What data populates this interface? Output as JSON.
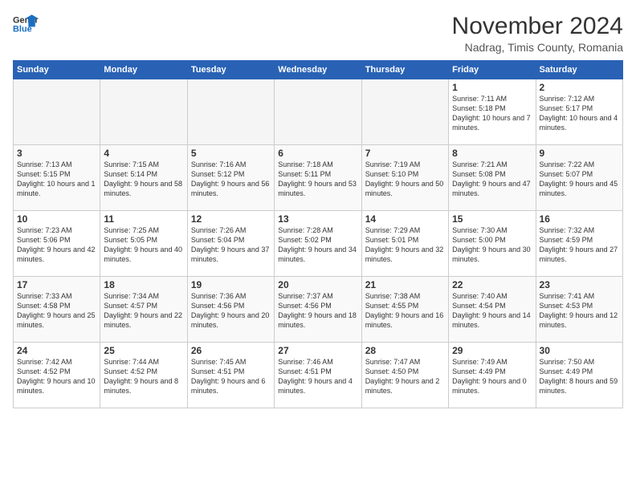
{
  "header": {
    "logo_line1": "General",
    "logo_line2": "Blue",
    "month": "November 2024",
    "location": "Nadrag, Timis County, Romania"
  },
  "weekdays": [
    "Sunday",
    "Monday",
    "Tuesday",
    "Wednesday",
    "Thursday",
    "Friday",
    "Saturday"
  ],
  "weeks": [
    [
      {
        "day": "",
        "info": ""
      },
      {
        "day": "",
        "info": ""
      },
      {
        "day": "",
        "info": ""
      },
      {
        "day": "",
        "info": ""
      },
      {
        "day": "",
        "info": ""
      },
      {
        "day": "1",
        "info": "Sunrise: 7:11 AM\nSunset: 5:18 PM\nDaylight: 10 hours\nand 7 minutes."
      },
      {
        "day": "2",
        "info": "Sunrise: 7:12 AM\nSunset: 5:17 PM\nDaylight: 10 hours\nand 4 minutes."
      }
    ],
    [
      {
        "day": "3",
        "info": "Sunrise: 7:13 AM\nSunset: 5:15 PM\nDaylight: 10 hours\nand 1 minute."
      },
      {
        "day": "4",
        "info": "Sunrise: 7:15 AM\nSunset: 5:14 PM\nDaylight: 9 hours\nand 58 minutes."
      },
      {
        "day": "5",
        "info": "Sunrise: 7:16 AM\nSunset: 5:12 PM\nDaylight: 9 hours\nand 56 minutes."
      },
      {
        "day": "6",
        "info": "Sunrise: 7:18 AM\nSunset: 5:11 PM\nDaylight: 9 hours\nand 53 minutes."
      },
      {
        "day": "7",
        "info": "Sunrise: 7:19 AM\nSunset: 5:10 PM\nDaylight: 9 hours\nand 50 minutes."
      },
      {
        "day": "8",
        "info": "Sunrise: 7:21 AM\nSunset: 5:08 PM\nDaylight: 9 hours\nand 47 minutes."
      },
      {
        "day": "9",
        "info": "Sunrise: 7:22 AM\nSunset: 5:07 PM\nDaylight: 9 hours\nand 45 minutes."
      }
    ],
    [
      {
        "day": "10",
        "info": "Sunrise: 7:23 AM\nSunset: 5:06 PM\nDaylight: 9 hours\nand 42 minutes."
      },
      {
        "day": "11",
        "info": "Sunrise: 7:25 AM\nSunset: 5:05 PM\nDaylight: 9 hours\nand 40 minutes."
      },
      {
        "day": "12",
        "info": "Sunrise: 7:26 AM\nSunset: 5:04 PM\nDaylight: 9 hours\nand 37 minutes."
      },
      {
        "day": "13",
        "info": "Sunrise: 7:28 AM\nSunset: 5:02 PM\nDaylight: 9 hours\nand 34 minutes."
      },
      {
        "day": "14",
        "info": "Sunrise: 7:29 AM\nSunset: 5:01 PM\nDaylight: 9 hours\nand 32 minutes."
      },
      {
        "day": "15",
        "info": "Sunrise: 7:30 AM\nSunset: 5:00 PM\nDaylight: 9 hours\nand 30 minutes."
      },
      {
        "day": "16",
        "info": "Sunrise: 7:32 AM\nSunset: 4:59 PM\nDaylight: 9 hours\nand 27 minutes."
      }
    ],
    [
      {
        "day": "17",
        "info": "Sunrise: 7:33 AM\nSunset: 4:58 PM\nDaylight: 9 hours\nand 25 minutes."
      },
      {
        "day": "18",
        "info": "Sunrise: 7:34 AM\nSunset: 4:57 PM\nDaylight: 9 hours\nand 22 minutes."
      },
      {
        "day": "19",
        "info": "Sunrise: 7:36 AM\nSunset: 4:56 PM\nDaylight: 9 hours\nand 20 minutes."
      },
      {
        "day": "20",
        "info": "Sunrise: 7:37 AM\nSunset: 4:56 PM\nDaylight: 9 hours\nand 18 minutes."
      },
      {
        "day": "21",
        "info": "Sunrise: 7:38 AM\nSunset: 4:55 PM\nDaylight: 9 hours\nand 16 minutes."
      },
      {
        "day": "22",
        "info": "Sunrise: 7:40 AM\nSunset: 4:54 PM\nDaylight: 9 hours\nand 14 minutes."
      },
      {
        "day": "23",
        "info": "Sunrise: 7:41 AM\nSunset: 4:53 PM\nDaylight: 9 hours\nand 12 minutes."
      }
    ],
    [
      {
        "day": "24",
        "info": "Sunrise: 7:42 AM\nSunset: 4:52 PM\nDaylight: 9 hours\nand 10 minutes."
      },
      {
        "day": "25",
        "info": "Sunrise: 7:44 AM\nSunset: 4:52 PM\nDaylight: 9 hours\nand 8 minutes."
      },
      {
        "day": "26",
        "info": "Sunrise: 7:45 AM\nSunset: 4:51 PM\nDaylight: 9 hours\nand 6 minutes."
      },
      {
        "day": "27",
        "info": "Sunrise: 7:46 AM\nSunset: 4:51 PM\nDaylight: 9 hours\nand 4 minutes."
      },
      {
        "day": "28",
        "info": "Sunrise: 7:47 AM\nSunset: 4:50 PM\nDaylight: 9 hours\nand 2 minutes."
      },
      {
        "day": "29",
        "info": "Sunrise: 7:49 AM\nSunset: 4:49 PM\nDaylight: 9 hours\nand 0 minutes."
      },
      {
        "day": "30",
        "info": "Sunrise: 7:50 AM\nSunset: 4:49 PM\nDaylight: 8 hours\nand 59 minutes."
      }
    ]
  ]
}
